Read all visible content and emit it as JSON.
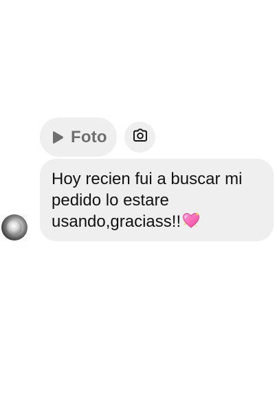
{
  "reply_chip": {
    "icon": "play-icon",
    "label": "Foto"
  },
  "camera_button": {
    "icon": "camera-icon"
  },
  "message": {
    "text": "Hoy recien fui a buscar mi pedido lo estare usando,graciass!!",
    "emoji": "sparkling-heart-emoji",
    "bubble_color": "#efefef"
  },
  "sender": {
    "avatar": "avatar"
  },
  "colors": {
    "chip_text": "#6e6e6e",
    "message_text": "#111111",
    "bubble": "#efefef",
    "background": "#ffffff"
  }
}
